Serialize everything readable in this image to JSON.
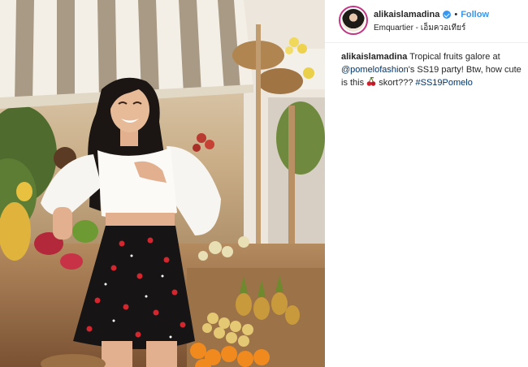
{
  "post": {
    "username": "alikaislamadina",
    "follow_label": "Follow",
    "separator": "•",
    "location": "Emquartier - เอ็มควอเทียร์",
    "caption": {
      "username": "alikaislamadina",
      "text_1": "Tropical fruits galore at",
      "mention": "@pomelofashion",
      "text_2": "'s SS19 party! Btw, how cute is this",
      "emoji": "cherries-icon",
      "text_3": "skort???",
      "hashtag": "#SS19Pomelo"
    },
    "photo": {
      "description_icon": "fashion-photo"
    }
  },
  "colors": {
    "link_blue": "#3897f0",
    "mention_blue": "#003569",
    "text": "#262626",
    "border": "#efefef"
  }
}
